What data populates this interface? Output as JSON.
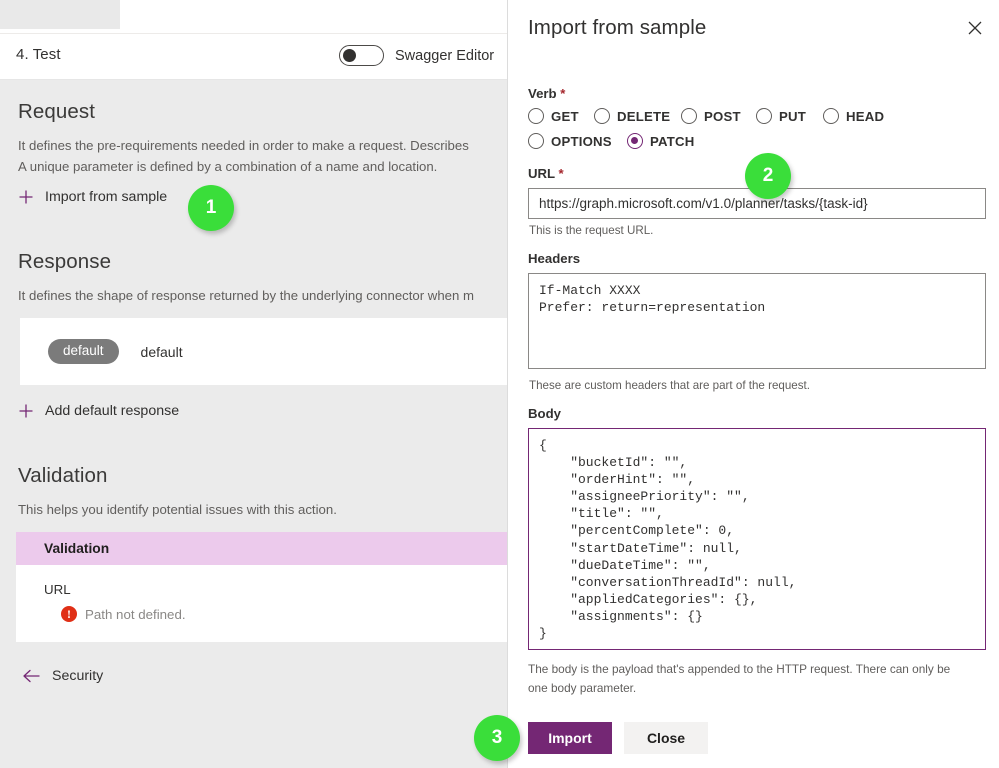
{
  "workspace": {
    "step_header": {
      "title": "4. Test",
      "toggle_label": "Swagger Editor",
      "toggle_state": "off"
    },
    "request_section": {
      "title": "Request",
      "description": "It defines the pre-requirements needed in order to make a request. Describes\nA unique parameter is defined by a combination of a name and location.",
      "import_link": "Import from sample"
    },
    "response_section": {
      "title": "Response",
      "description": "It defines the shape of response returned by the underlying connector when m",
      "row_pill": "default",
      "row_label": "default",
      "add_link": "Add default response"
    },
    "validation_section": {
      "title": "Validation",
      "description": "This helps you identify potential issues with this action.",
      "table_header": "Validation",
      "field_label": "URL",
      "error_text": "Path not defined."
    },
    "security_link": "Security"
  },
  "import_panel": {
    "title": "Import from sample",
    "verb": {
      "label": "Verb",
      "required": true,
      "options": [
        {
          "label": "GET",
          "checked": false
        },
        {
          "label": "DELETE",
          "checked": false
        },
        {
          "label": "POST",
          "checked": false
        },
        {
          "label": "PUT",
          "checked": false
        },
        {
          "label": "HEAD",
          "checked": false
        },
        {
          "label": "OPTIONS",
          "checked": false
        },
        {
          "label": "PATCH",
          "checked": true
        }
      ],
      "selected": "PATCH"
    },
    "url": {
      "label": "URL",
      "required": true,
      "value": "https://graph.microsoft.com/v1.0/planner/tasks/{task-id}",
      "placeholder": "",
      "hint": "This is the request URL."
    },
    "headers": {
      "label": "Headers",
      "value": "If-Match XXXX\nPrefer: return=representation",
      "placeholder": "",
      "hint": "These are custom headers that are part of the request."
    },
    "body": {
      "label": "Body",
      "value": "{\n    \"bucketId\": \"\",\n    \"orderHint\": \"\",\n    \"assigneePriority\": \"\",\n    \"title\": \"\",\n    \"percentComplete\": 0,\n    \"startDateTime\": null,\n    \"dueDateTime\": \"\",\n    \"conversationThreadId\": null,\n    \"appliedCategories\": {},\n    \"assignments\": {}\n}",
      "placeholder": "",
      "hint": "The body is the payload that's appended to the HTTP request. There can only be one body parameter."
    },
    "actions": {
      "import_label": "Import",
      "close_label": "Close"
    }
  },
  "callouts": [
    {
      "number": "1",
      "target": "import-from-sample-link"
    },
    {
      "number": "2",
      "target": "verb-patch-radio"
    },
    {
      "number": "3",
      "target": "import-button"
    }
  ],
  "colors": {
    "brand_purple": "#742774",
    "callout_green": "#3ade3a",
    "error_red": "#e02f16",
    "table_header_pink": "#eccaec",
    "pane_background": "#ebebeb",
    "pill_gray": "#7b7b7b"
  }
}
